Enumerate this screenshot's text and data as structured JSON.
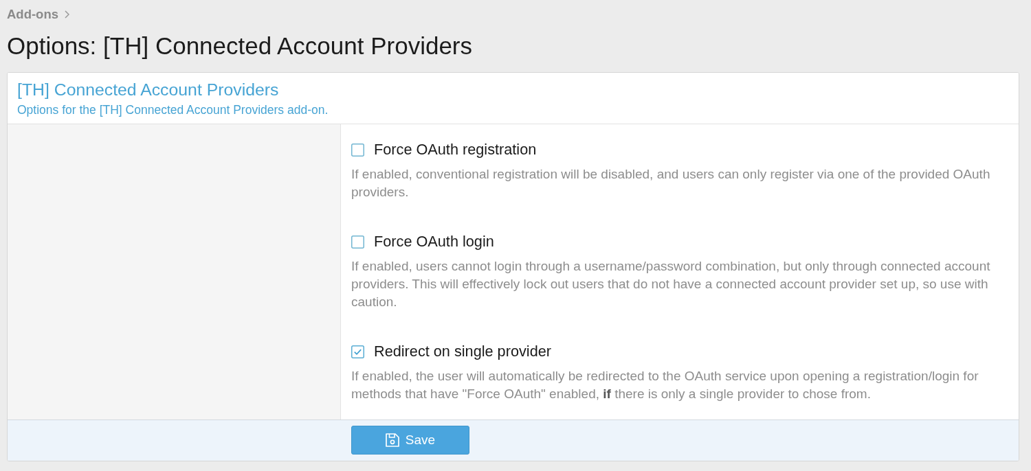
{
  "breadcrumb": [
    {
      "label": "Add-ons"
    }
  ],
  "page_title": "Options: [TH] Connected Account Providers",
  "panel": {
    "title": "[TH] Connected Account Providers",
    "description": "Options for the [TH] Connected Account Providers add-on."
  },
  "options": [
    {
      "label": "Force OAuth registration",
      "checked": false,
      "description": "If enabled, conventional registration will be disabled, and users can only register via one of the provided OAuth providers."
    },
    {
      "label": "Force OAuth login",
      "checked": false,
      "description": "If enabled, users cannot login through a username/password combination, but only through connected account providers. This will effectively lock out users that do not have a connected account provider set up, so use with caution."
    },
    {
      "label": "Redirect on single provider",
      "checked": true,
      "description": "If enabled, the user will automatically be redirected to the OAuth service upon opening a registration/login for methods that have \"Force OAuth\" enabled, **if** there is only a single provider to chose from."
    }
  ],
  "save_button": {
    "label": "Save"
  }
}
